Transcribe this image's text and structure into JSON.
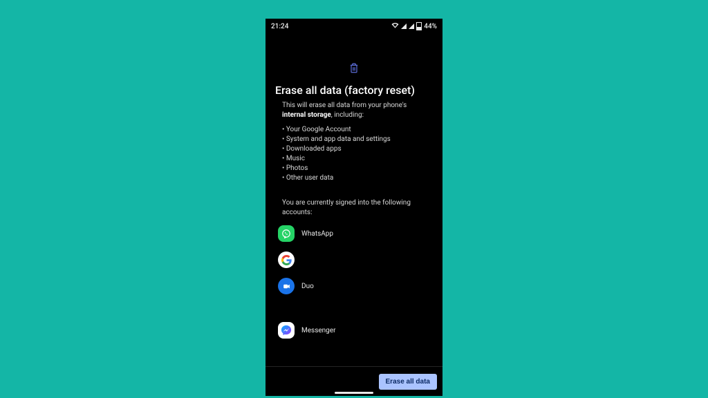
{
  "status": {
    "time": "21:24",
    "battery": "44%"
  },
  "title": "Erase all data (factory reset)",
  "desc": {
    "line1a": "This will erase all data from your phone's",
    "strong": "internal storage",
    "line1b": ", including:"
  },
  "bullets": [
    "Your Google Account",
    "System and app data and settings",
    "Downloaded apps",
    "Music",
    "Photos",
    "Other user data"
  ],
  "signed_in": {
    "line1": "You are currently signed into the following",
    "line2": "accounts:"
  },
  "accounts": [
    {
      "label": "WhatsApp"
    },
    {
      "label": ""
    },
    {
      "label": "Duo"
    },
    {
      "label": "Messenger"
    }
  ],
  "button": {
    "label": "Erase all data"
  }
}
